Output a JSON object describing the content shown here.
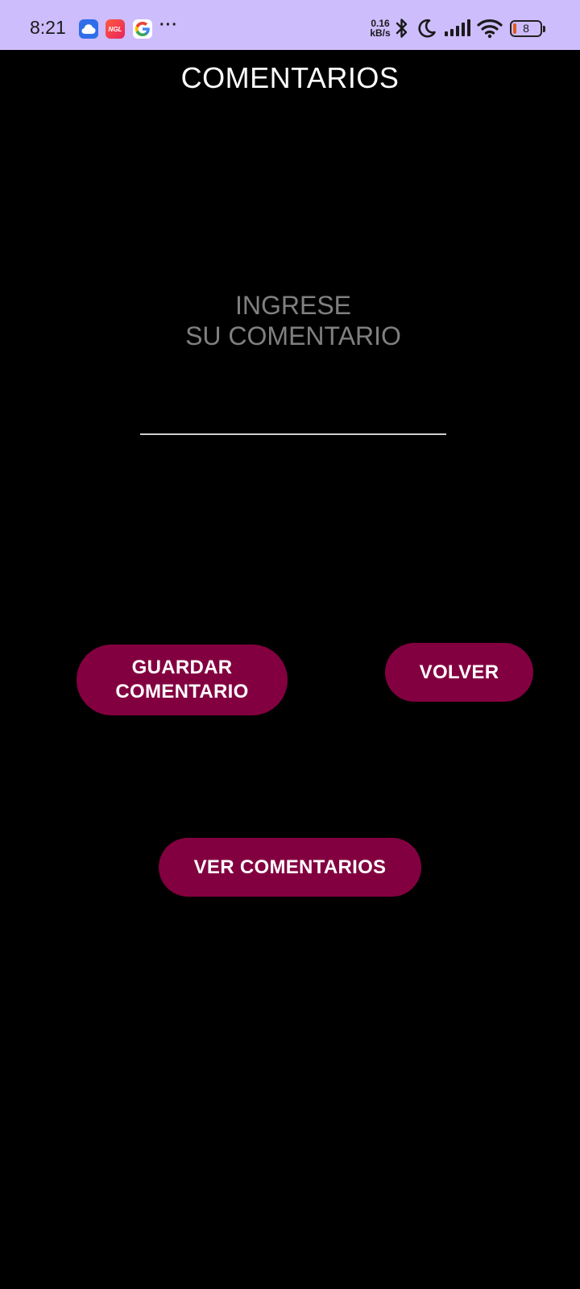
{
  "status_bar": {
    "time": "8:21",
    "notification_icons": [
      "cloud-icon",
      "ngl-icon",
      "google-icon"
    ],
    "ngl_label": "NGL",
    "more_label": "···",
    "net_speed_value": "0.16",
    "net_speed_unit": "kB/s",
    "battery_level": "8",
    "color": "#cdbdfd"
  },
  "screen": {
    "title": "COMENTARIOS",
    "comment_input": {
      "placeholder": "INGRESE\nSU COMENTARIO",
      "value": ""
    },
    "buttons": {
      "save_label": "GUARDAR\nCOMENTARIO",
      "back_label": "VOLVER",
      "view_label": "VER COMENTARIOS"
    },
    "accent_color": "#830040",
    "background_color": "#000000"
  }
}
